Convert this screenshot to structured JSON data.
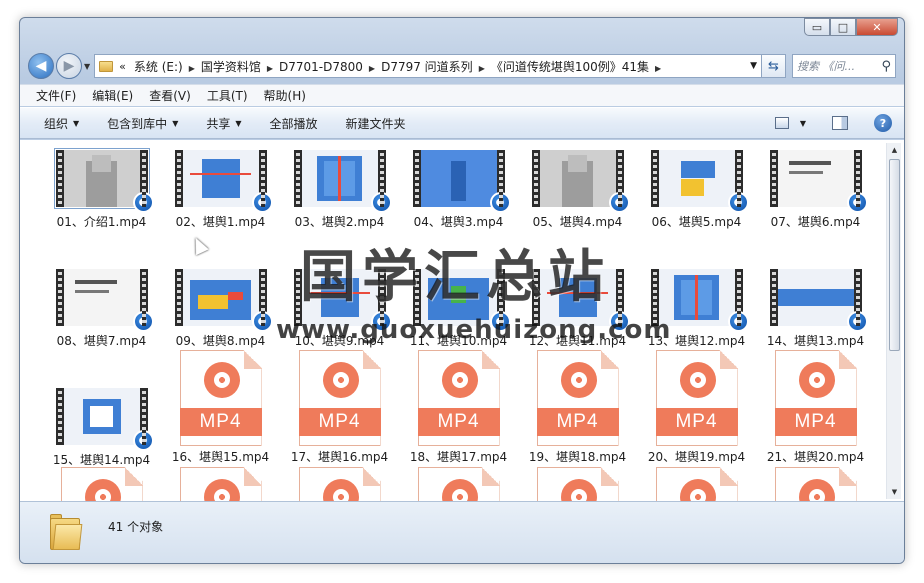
{
  "window": {
    "controls": {
      "minimize": "▭",
      "maximize": "□",
      "close": "✕"
    }
  },
  "nav": {
    "back_glyph": "◀",
    "forward_glyph": "▶",
    "history_glyph": "▼",
    "more_glyph": "«",
    "breadcrumbs": [
      "系统 (E:)",
      "国学资料馆",
      "D7701-D7800",
      "D7797 问道系列",
      "《问道传统堪舆100例》41集"
    ],
    "crumb_sep": "▶",
    "dropdown_glyph": "▼",
    "refresh_glyph": "⇆",
    "search_placeholder": "搜索 《问...",
    "search_glyph": "⚲"
  },
  "menu": [
    "文件(F)",
    "编辑(E)",
    "查看(V)",
    "工具(T)",
    "帮助(H)"
  ],
  "toolbar": {
    "buttons": [
      {
        "label": "组织",
        "dropdown": true
      },
      {
        "label": "包含到库中",
        "dropdown": true
      },
      {
        "label": "共享",
        "dropdown": true
      },
      {
        "label": "全部播放",
        "dropdown": false
      },
      {
        "label": "新建文件夹",
        "dropdown": false
      }
    ],
    "caret": "▼",
    "help_glyph": "?"
  },
  "files": {
    "thumbnails": [
      {
        "label": "01、介绍1.mp4",
        "scene": "person",
        "selected": true
      },
      {
        "label": "02、堪舆1.mp4",
        "scene": "blue-red"
      },
      {
        "label": "03、堪舆2.mp4",
        "scene": "blue-grid"
      },
      {
        "label": "04、堪舆3.mp4",
        "scene": "blue-full"
      },
      {
        "label": "05、堪舆4.mp4",
        "scene": "person"
      },
      {
        "label": "06、堪舆5.mp4",
        "scene": "blue-yellow"
      },
      {
        "label": "07、堪舆6.mp4",
        "scene": "text"
      },
      {
        "label": "08、堪舆7.mp4",
        "scene": "text"
      },
      {
        "label": "09、堪舆8.mp4",
        "scene": "blue-yellow-red"
      },
      {
        "label": "10、堪舆9.mp4",
        "scene": "blue-red"
      },
      {
        "label": "11、堪舆10.mp4",
        "scene": "blue-green"
      },
      {
        "label": "12、堪舆11.mp4",
        "scene": "blue-red"
      },
      {
        "label": "13、堪舆12.mp4",
        "scene": "blue-grid"
      },
      {
        "label": "14、堪舆13.mp4",
        "scene": "blue-band"
      },
      {
        "label": "15、堪舆14.mp4",
        "scene": "blue-square"
      }
    ],
    "mp4_icons": [
      "16、堪舆15.mp4",
      "17、堪舆16.mp4",
      "18、堪舆17.mp4",
      "19、堪舆18.mp4",
      "20、堪舆19.mp4",
      "21、堪舆20.mp4"
    ],
    "mp4_badge_text": "MP4",
    "partial_count": 7,
    "badge_glyph": "●"
  },
  "status": {
    "text": "41 个对象"
  },
  "watermark": {
    "title": "国学汇总站",
    "url": "www.guoxuehuizong.com"
  },
  "colors": {
    "mp4_accent": "#ef7b5b",
    "video_blue": "#3f7fd4"
  }
}
